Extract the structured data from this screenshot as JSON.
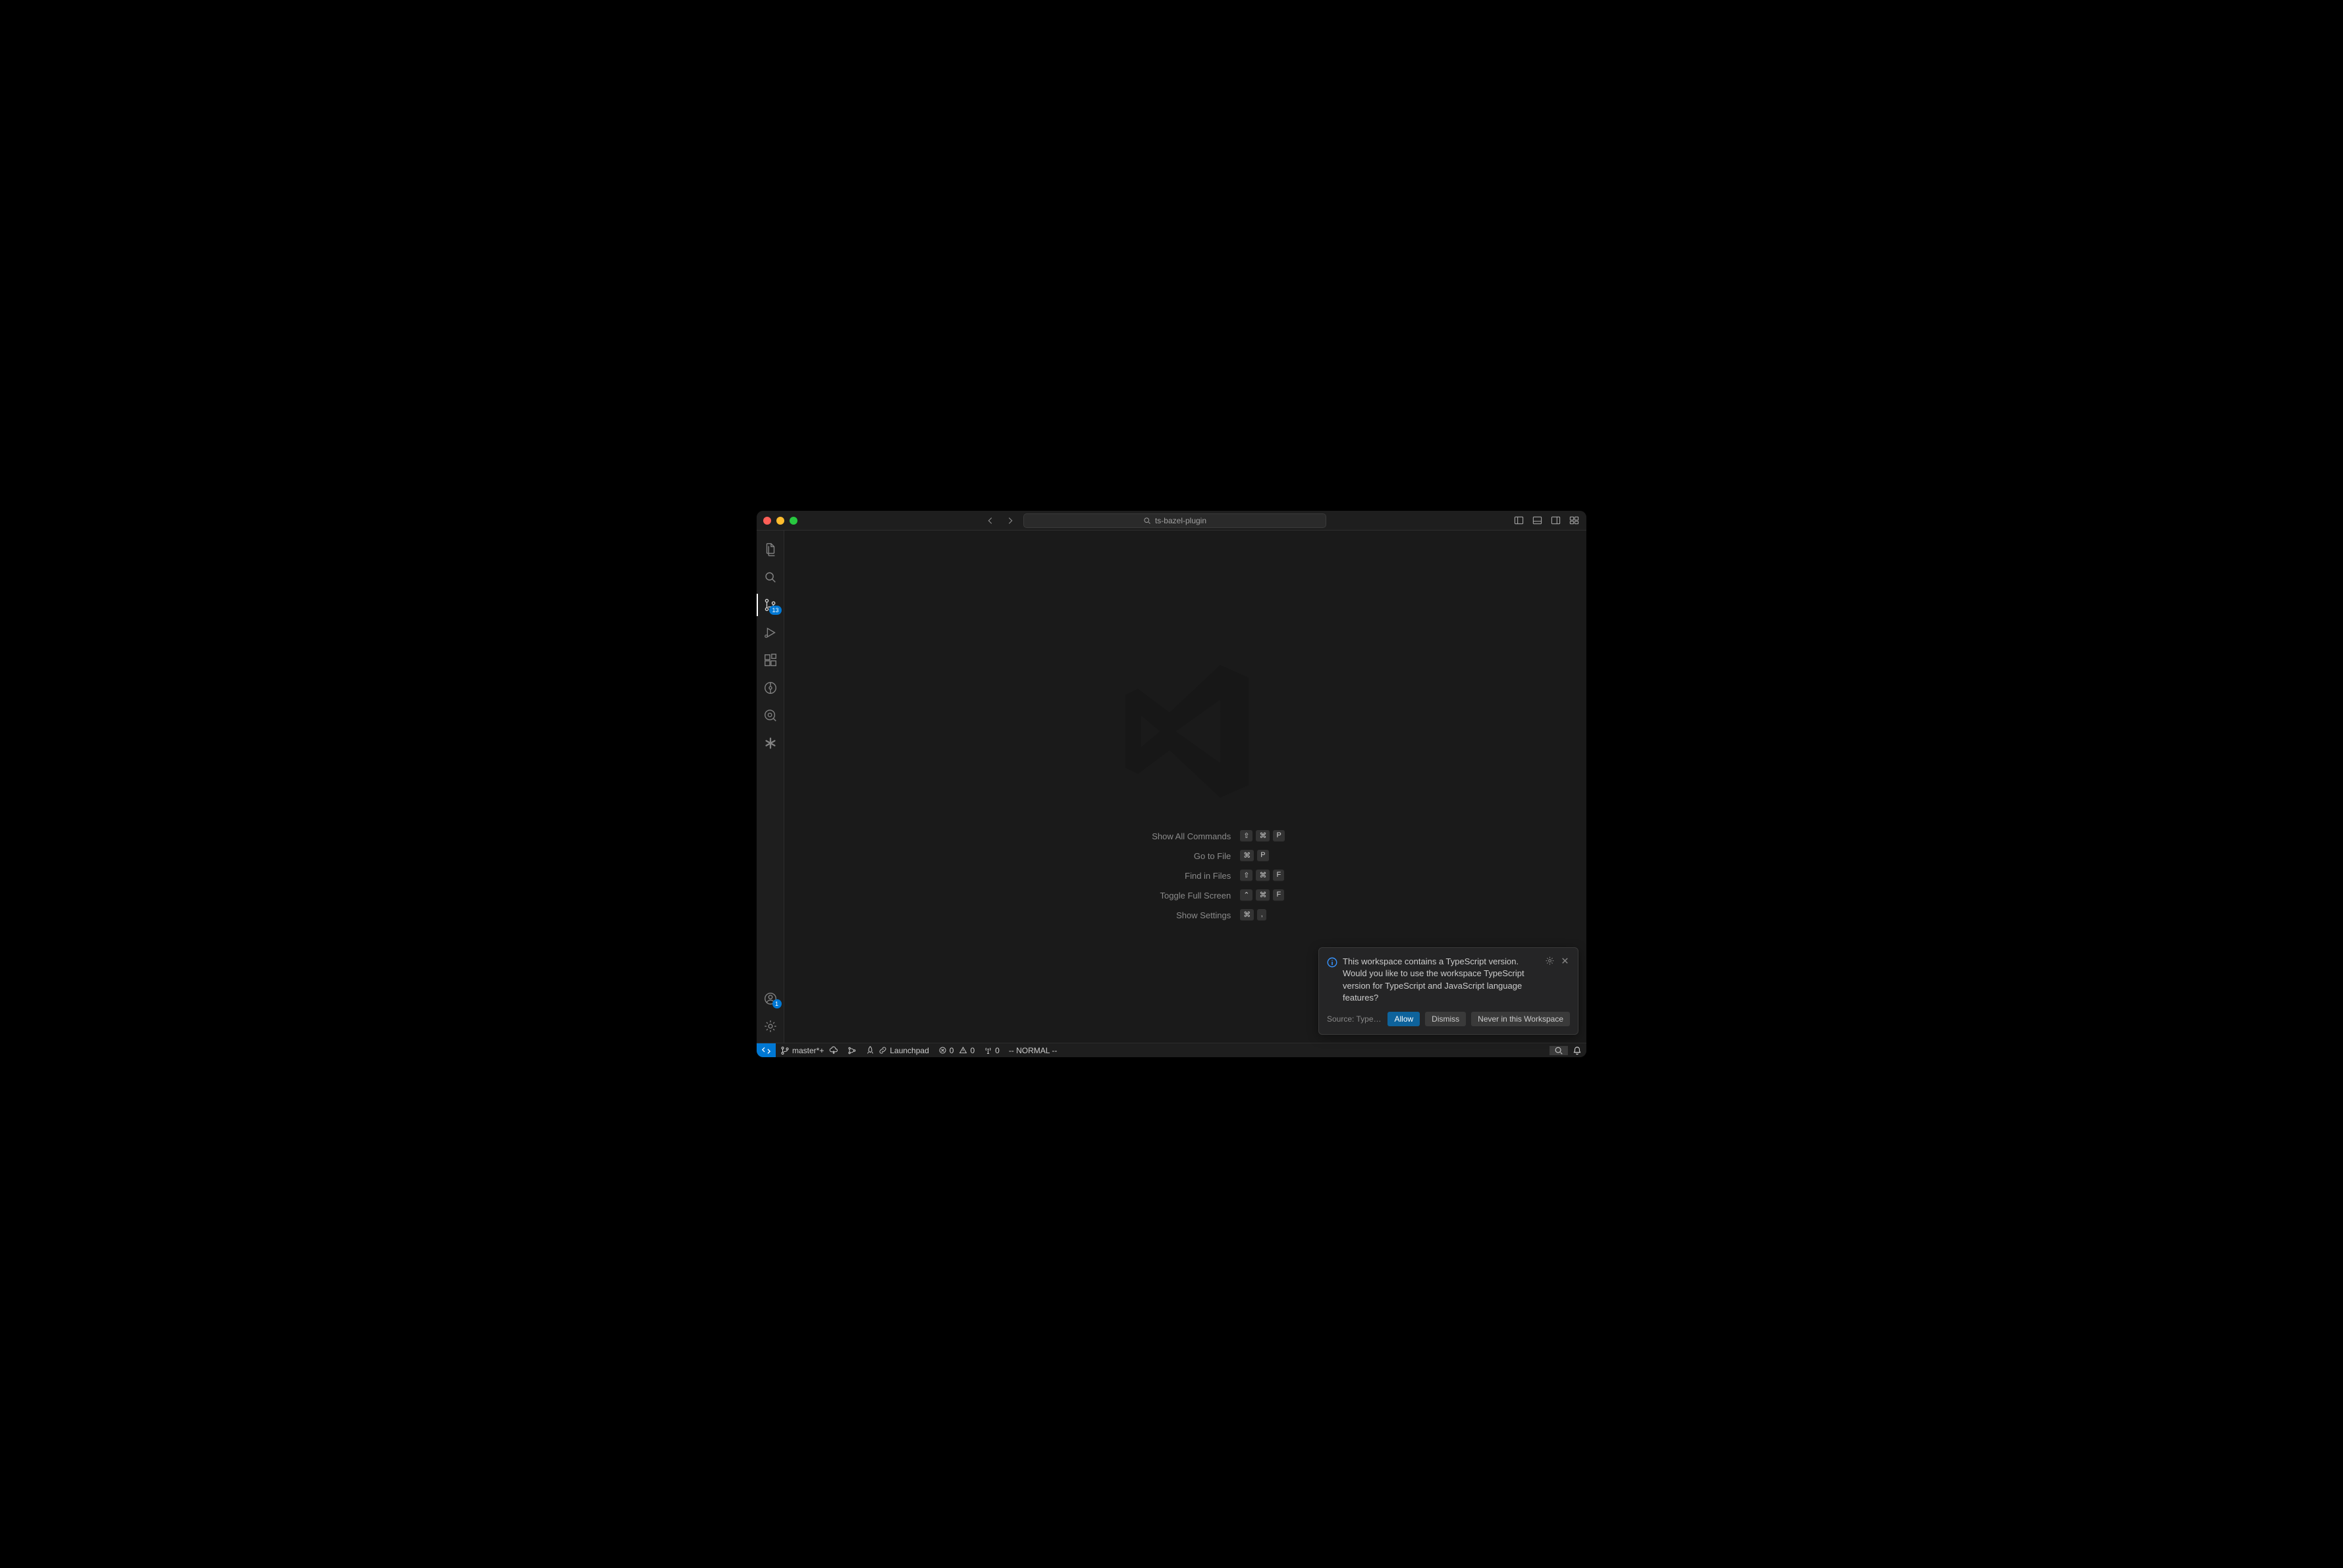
{
  "titlebar": {
    "search_text": "ts-bazel-plugin"
  },
  "activity": {
    "scm_badge": "13",
    "accounts_badge": "1"
  },
  "welcome": {
    "shortcuts": [
      {
        "label": "Show All Commands",
        "keys": [
          "⇧",
          "⌘",
          "P"
        ]
      },
      {
        "label": "Go to File",
        "keys": [
          "⌘",
          "P"
        ]
      },
      {
        "label": "Find in Files",
        "keys": [
          "⇧",
          "⌘",
          "F"
        ]
      },
      {
        "label": "Toggle Full Screen",
        "keys": [
          "⌃",
          "⌘",
          "F"
        ]
      },
      {
        "label": "Show Settings",
        "keys": [
          "⌘",
          ","
        ]
      }
    ]
  },
  "notification": {
    "message": "This workspace contains a TypeScript version. Would you like to use the workspace TypeScript version for TypeScript and JavaScript language features?",
    "source": "Source: TypeScript a…",
    "allow": "Allow",
    "dismiss": "Dismiss",
    "never": "Never in this Workspace"
  },
  "statusbar": {
    "branch": "master*+",
    "launchpad": "Launchpad",
    "errors": "0",
    "warnings": "0",
    "ports": "0",
    "vim_mode": "-- NORMAL --"
  }
}
